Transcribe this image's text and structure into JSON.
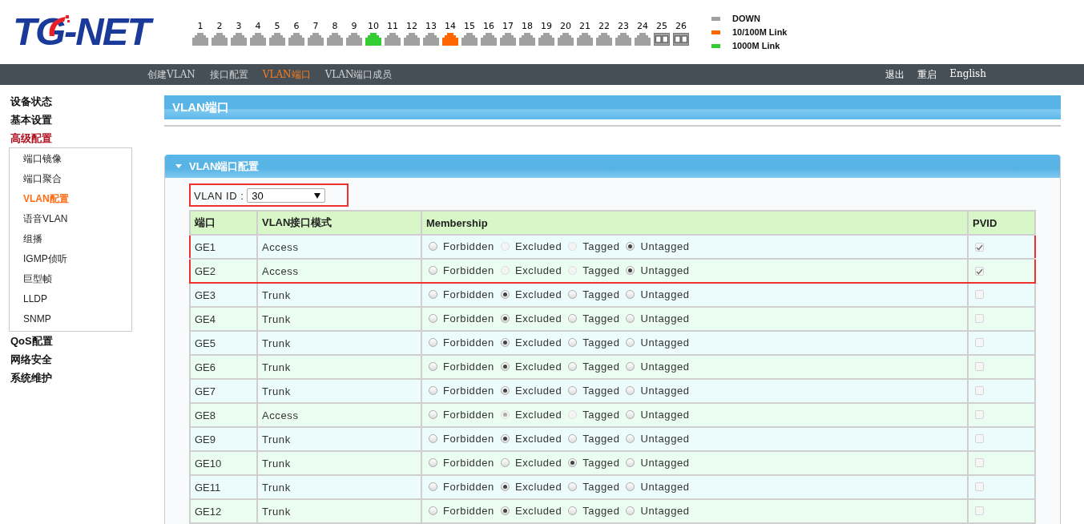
{
  "logo": "TG-NET",
  "ports": [
    {
      "number": "1",
      "kind": "rj45",
      "color": "#a0a0a0"
    },
    {
      "number": "2",
      "kind": "rj45",
      "color": "#a0a0a0"
    },
    {
      "number": "3",
      "kind": "rj45",
      "color": "#a0a0a0"
    },
    {
      "number": "4",
      "kind": "rj45",
      "color": "#a0a0a0"
    },
    {
      "number": "5",
      "kind": "rj45",
      "color": "#a0a0a0"
    },
    {
      "number": "6",
      "kind": "rj45",
      "color": "#a0a0a0"
    },
    {
      "number": "7",
      "kind": "rj45",
      "color": "#a0a0a0"
    },
    {
      "number": "8",
      "kind": "rj45",
      "color": "#a0a0a0"
    },
    {
      "number": "9",
      "kind": "rj45",
      "color": "#a0a0a0"
    },
    {
      "number": "10",
      "kind": "rj45",
      "color": "#33cc33"
    },
    {
      "number": "11",
      "kind": "rj45",
      "color": "#a0a0a0"
    },
    {
      "number": "12",
      "kind": "rj45",
      "color": "#a0a0a0"
    },
    {
      "number": "13",
      "kind": "rj45",
      "color": "#a0a0a0"
    },
    {
      "number": "14",
      "kind": "rj45",
      "color": "#ff6600"
    },
    {
      "number": "15",
      "kind": "rj45",
      "color": "#a0a0a0"
    },
    {
      "number": "16",
      "kind": "rj45",
      "color": "#a0a0a0"
    },
    {
      "number": "17",
      "kind": "rj45",
      "color": "#a0a0a0"
    },
    {
      "number": "18",
      "kind": "rj45",
      "color": "#a0a0a0"
    },
    {
      "number": "19",
      "kind": "rj45",
      "color": "#a0a0a0"
    },
    {
      "number": "20",
      "kind": "rj45",
      "color": "#a0a0a0"
    },
    {
      "number": "21",
      "kind": "rj45",
      "color": "#a0a0a0"
    },
    {
      "number": "22",
      "kind": "rj45",
      "color": "#a0a0a0"
    },
    {
      "number": "23",
      "kind": "rj45",
      "color": "#a0a0a0"
    },
    {
      "number": "24",
      "kind": "rj45",
      "color": "#a0a0a0"
    },
    {
      "number": "25",
      "kind": "sfp",
      "color": "#a0a0a0"
    },
    {
      "number": "26",
      "kind": "sfp",
      "color": "#a0a0a0"
    }
  ],
  "legend": [
    {
      "label": "DOWN",
      "color": "#a0a0a0"
    },
    {
      "label": "10/100M Link",
      "color": "#ff6600"
    },
    {
      "label": "1000M Link",
      "color": "#33cc33"
    }
  ],
  "nav_tabs": [
    {
      "label": "创建VLAN",
      "selected": false
    },
    {
      "label": "接口配置",
      "selected": false
    },
    {
      "label": "VLAN端口",
      "selected": true
    },
    {
      "label": "VLAN端口成员",
      "selected": false
    }
  ],
  "top_links": [
    "退出",
    "重启",
    "English"
  ],
  "sidebar": {
    "items": [
      {
        "label": "设备状态",
        "selected": false
      },
      {
        "label": "基本设置",
        "selected": false
      },
      {
        "label": "高级配置",
        "selected": true,
        "children": [
          {
            "label": "端口镜像",
            "selected": false
          },
          {
            "label": "端口聚合",
            "selected": false
          },
          {
            "label": "VLAN配置",
            "selected": true
          },
          {
            "label": "语音VLAN",
            "selected": false
          },
          {
            "label": "组播",
            "selected": false
          },
          {
            "label": "IGMP侦听",
            "selected": false
          },
          {
            "label": "巨型帧",
            "selected": false
          },
          {
            "label": "LLDP",
            "selected": false
          },
          {
            "label": "SNMP",
            "selected": false
          }
        ]
      },
      {
        "label": "QoS配置",
        "selected": false
      },
      {
        "label": "网络安全",
        "selected": false
      },
      {
        "label": "系统维护",
        "selected": false
      }
    ]
  },
  "page_title": "VLAN端口",
  "section": {
    "title": "VLAN端口配置",
    "expanded": true
  },
  "vlan_id": {
    "label": "VLAN ID :",
    "value": "30",
    "highlighted": true
  },
  "table": {
    "columns": [
      "端口",
      "VLAN接口模式",
      "Membership",
      "PVID"
    ],
    "rows": [
      {
        "port": "GE1",
        "mode": "Access",
        "highlighted": true,
        "pvid_checked": true,
        "pvid_disabled": true,
        "options": [
          {
            "label": "Forbidden",
            "selected": false,
            "disabled": false
          },
          {
            "label": "Excluded",
            "selected": false,
            "disabled": true
          },
          {
            "label": "Tagged",
            "selected": false,
            "disabled": true
          },
          {
            "label": "Untagged",
            "selected": true,
            "disabled": false
          }
        ]
      },
      {
        "port": "GE2",
        "mode": "Access",
        "highlighted": true,
        "pvid_checked": true,
        "pvid_disabled": true,
        "options": [
          {
            "label": "Forbidden",
            "selected": false,
            "disabled": false
          },
          {
            "label": "Excluded",
            "selected": false,
            "disabled": true
          },
          {
            "label": "Tagged",
            "selected": false,
            "disabled": true
          },
          {
            "label": "Untagged",
            "selected": true,
            "disabled": false
          }
        ]
      },
      {
        "port": "GE3",
        "mode": "Trunk",
        "highlighted": false,
        "pvid_checked": false,
        "pvid_disabled": true,
        "options": [
          {
            "label": "Forbidden",
            "selected": false,
            "disabled": false
          },
          {
            "label": "Excluded",
            "selected": true,
            "disabled": false
          },
          {
            "label": "Tagged",
            "selected": false,
            "disabled": false
          },
          {
            "label": "Untagged",
            "selected": false,
            "disabled": false
          }
        ]
      },
      {
        "port": "GE4",
        "mode": "Trunk",
        "highlighted": false,
        "pvid_checked": false,
        "pvid_disabled": true,
        "options": [
          {
            "label": "Forbidden",
            "selected": false,
            "disabled": false
          },
          {
            "label": "Excluded",
            "selected": true,
            "disabled": false
          },
          {
            "label": "Tagged",
            "selected": false,
            "disabled": false
          },
          {
            "label": "Untagged",
            "selected": false,
            "disabled": false
          }
        ]
      },
      {
        "port": "GE5",
        "mode": "Trunk",
        "highlighted": false,
        "pvid_checked": false,
        "pvid_disabled": true,
        "options": [
          {
            "label": "Forbidden",
            "selected": false,
            "disabled": false
          },
          {
            "label": "Excluded",
            "selected": true,
            "disabled": false
          },
          {
            "label": "Tagged",
            "selected": false,
            "disabled": false
          },
          {
            "label": "Untagged",
            "selected": false,
            "disabled": false
          }
        ]
      },
      {
        "port": "GE6",
        "mode": "Trunk",
        "highlighted": false,
        "pvid_checked": false,
        "pvid_disabled": true,
        "options": [
          {
            "label": "Forbidden",
            "selected": false,
            "disabled": false
          },
          {
            "label": "Excluded",
            "selected": true,
            "disabled": false
          },
          {
            "label": "Tagged",
            "selected": false,
            "disabled": false
          },
          {
            "label": "Untagged",
            "selected": false,
            "disabled": false
          }
        ]
      },
      {
        "port": "GE7",
        "mode": "Trunk",
        "highlighted": false,
        "pvid_checked": false,
        "pvid_disabled": true,
        "options": [
          {
            "label": "Forbidden",
            "selected": false,
            "disabled": false
          },
          {
            "label": "Excluded",
            "selected": true,
            "disabled": false
          },
          {
            "label": "Tagged",
            "selected": false,
            "disabled": false
          },
          {
            "label": "Untagged",
            "selected": false,
            "disabled": false
          }
        ]
      },
      {
        "port": "GE8",
        "mode": "Access",
        "highlighted": false,
        "pvid_checked": false,
        "pvid_disabled": true,
        "options": [
          {
            "label": "Forbidden",
            "selected": false,
            "disabled": false
          },
          {
            "label": "Excluded",
            "selected": true,
            "disabled": true
          },
          {
            "label": "Tagged",
            "selected": false,
            "disabled": true
          },
          {
            "label": "Untagged",
            "selected": false,
            "disabled": false
          }
        ]
      },
      {
        "port": "GE9",
        "mode": "Trunk",
        "highlighted": false,
        "pvid_checked": false,
        "pvid_disabled": true,
        "options": [
          {
            "label": "Forbidden",
            "selected": false,
            "disabled": false
          },
          {
            "label": "Excluded",
            "selected": true,
            "disabled": false
          },
          {
            "label": "Tagged",
            "selected": false,
            "disabled": false
          },
          {
            "label": "Untagged",
            "selected": false,
            "disabled": false
          }
        ]
      },
      {
        "port": "GE10",
        "mode": "Trunk",
        "highlighted": false,
        "pvid_checked": false,
        "pvid_disabled": true,
        "options": [
          {
            "label": "Forbidden",
            "selected": false,
            "disabled": false
          },
          {
            "label": "Excluded",
            "selected": false,
            "disabled": false
          },
          {
            "label": "Tagged",
            "selected": true,
            "disabled": false
          },
          {
            "label": "Untagged",
            "selected": false,
            "disabled": false
          }
        ]
      },
      {
        "port": "GE11",
        "mode": "Trunk",
        "highlighted": false,
        "pvid_checked": false,
        "pvid_disabled": true,
        "options": [
          {
            "label": "Forbidden",
            "selected": false,
            "disabled": false
          },
          {
            "label": "Excluded",
            "selected": true,
            "disabled": false
          },
          {
            "label": "Tagged",
            "selected": false,
            "disabled": false
          },
          {
            "label": "Untagged",
            "selected": false,
            "disabled": false
          }
        ]
      },
      {
        "port": "GE12",
        "mode": "Trunk",
        "highlighted": false,
        "pvid_checked": false,
        "pvid_disabled": true,
        "options": [
          {
            "label": "Forbidden",
            "selected": false,
            "disabled": false
          },
          {
            "label": "Excluded",
            "selected": true,
            "disabled": false
          },
          {
            "label": "Tagged",
            "selected": false,
            "disabled": false
          },
          {
            "label": "Untagged",
            "selected": false,
            "disabled": false
          }
        ]
      }
    ]
  }
}
